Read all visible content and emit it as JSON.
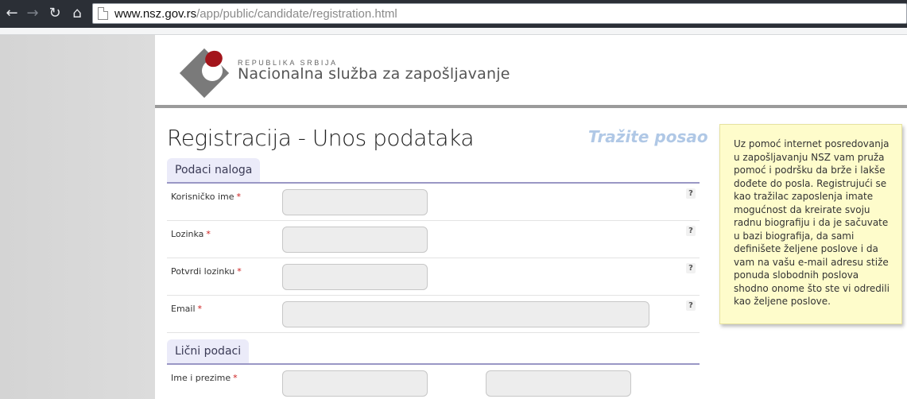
{
  "browser": {
    "url_host": "www.nsz.gov.rs",
    "url_path": "/app/public/candidate/registration.html"
  },
  "header": {
    "republic": "REPUBLIKA SRBIJA",
    "agency": "Nacionalna služba za zapošljavanje"
  },
  "page": {
    "title": "Registracija - Unos podataka",
    "tagline": "Tražite posao"
  },
  "sections": {
    "account": {
      "heading": "Podaci naloga",
      "fields": [
        {
          "label": "Korisničko ime",
          "required": "*",
          "value": ""
        },
        {
          "label": "Lozinka",
          "required": "*",
          "value": ""
        },
        {
          "label": "Potvrdi lozinku",
          "required": "*",
          "value": ""
        },
        {
          "label": "Email",
          "required": "*",
          "value": ""
        }
      ],
      "help_label": "?"
    },
    "personal": {
      "heading": "Lični podaci",
      "fields": [
        {
          "label": "Ime i prezime",
          "required": "*",
          "value": ""
        }
      ]
    }
  },
  "info_text": "Uz pomoć internet posredovanja u zapošljavanju NSZ vam pruža pomoć i podršku da brže i lakše dođete do posla. Registrujući se kao tražilac zaposlenja imate mogućnost da kreirate svoju radnu biografiju i da je sačuvate u bazi biografija, da sami definišete željene poslove i da vam na vašu e-mail adresu stiže ponuda slobodnih poslova shodno onome što ste vi odredili kao željene poslove.",
  "colors": {
    "required": "#cc1c1c",
    "section_tab": "#ebebf9",
    "info_bg": "#fefccb",
    "tagline": "#b0c8e6",
    "logo_red": "#a3151b"
  }
}
